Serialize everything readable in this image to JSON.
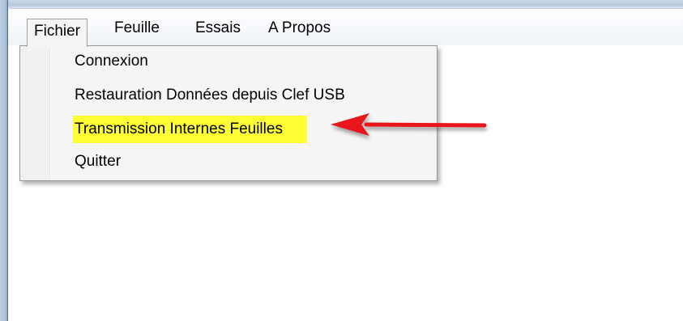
{
  "menubar": {
    "items": [
      {
        "label": "Fichier",
        "active": true
      },
      {
        "label": "Feuille"
      },
      {
        "label": "Essais"
      },
      {
        "label": "A Propos"
      }
    ]
  },
  "dropdown": {
    "items": [
      {
        "label": "Connexion"
      },
      {
        "label": "Restauration Données depuis Clef USB"
      },
      {
        "label": "Transmission Internes Feuilles",
        "highlighted": true
      },
      {
        "label": "Quitter"
      }
    ]
  },
  "annotation": {
    "arrow_color": "#e8141b",
    "highlight_color": "#ffff33",
    "icon": "red-arrow-icon"
  }
}
